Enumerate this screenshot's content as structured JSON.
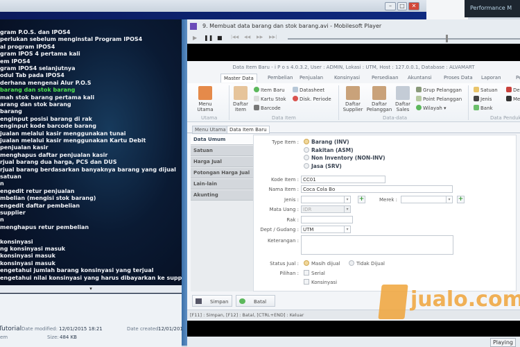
{
  "background_window": {
    "min": "–",
    "max": "□",
    "close": "✕"
  },
  "taskbar": {
    "performance_label": "Performance M"
  },
  "tutorial_list": {
    "items": [
      "gram P.O.S. dan IPOS4",
      "perlukan sebelum menginstal Program IPOS4",
      "al program IPOS4",
      "gram IPOS 4 pertama kali",
      "em IPOS4",
      "gram IPOS4 selanjutnya",
      "odul Tab pada IPOS4",
      "derhana mengenai Alur P.O.S",
      "barang dan stok barang",
      "mah stok barang pertama kali",
      "arang dan stok barang",
      "barang",
      "enginput posisi barang di rak",
      "enginput kode barcode barang",
      "jualan melalui kasir menggunakan tunai",
      "jualan melalui kasir menggunakan Kartu Debit",
      "penjualan kasir",
      "menghapus daftar penjualan kasir",
      "rjual barang dua harga, PCS dan DUS",
      "rjual barang berdasarkan banyaknya barang yang dijual",
      "satuan",
      "n",
      "engedit retur penjualan",
      "mbelian (mengisi stok barang)",
      "engedit daftar pembelian",
      "supplier",
      "n",
      "menghapus retur pembelian",
      "",
      "konsinyasi",
      "ng konsinyasi masuk",
      "konsinyasi masuk",
      "konsinyasi masuk",
      "engetahui jumlah barang konsinyasi yang terjual",
      "engetahui nilai konsinyasi yang harus dibayarkan ke supplier"
    ],
    "highlighted_index": 8,
    "highlight_color": "#4ee24e",
    "scroll_down": "▾"
  },
  "explorer_details": {
    "name": "Tutorial",
    "type": "em",
    "date_modified_label": "Date modified:",
    "date_modified": "12/01/2015 18:21",
    "size_label": "Size:",
    "size": "484 KB",
    "date_created_label": "Date created:",
    "date_created": "12/01/201"
  },
  "player": {
    "title": "9.  Membuat data barang dan stok barang.avi - Mobilesoft Player",
    "controls": [
      "▶",
      "❚❚",
      "■",
      "|◀◀",
      "◀◀",
      "▶▶",
      "▶▶|"
    ],
    "seek_progress": 0.68,
    "status": "Playing"
  },
  "app": {
    "title": "Data Item Baru - i P o s 4.0.3.2,  User : ADMIN, Lokasi : UTM, Host : 127.0.0.1, Database : ALVAMART",
    "tabs": [
      "Master Data",
      "Pembelian",
      "Penjualan",
      "Konsinyasi",
      "Persediaan",
      "Akuntansi",
      "Proses Data",
      "Laporan",
      "Pe"
    ],
    "active_tab": "Master Data",
    "ribbon": {
      "utama": {
        "label": "Utama",
        "menu_utama": "Menu Utama"
      },
      "data_item": {
        "label": "Data Item",
        "daftar_item": "Daftar Item",
        "item_baru": "Item Baru",
        "kartu_stok": "Kartu Stok",
        "barcode": "Barcode",
        "datasheet": "Datasheet",
        "disk_periode": "Disk. Periode"
      },
      "data_data": {
        "label": "Data-data",
        "daftar_supplier": "Daftar Supplier",
        "daftar_pelanggan": "Daftar Pelanggan",
        "daftar_sales": "Daftar Sales",
        "grup_pelanggan": "Grup Pelanggan",
        "point_pelanggan": "Point Pelanggan",
        "wilayah": "Wilayah ▾"
      },
      "data_pendukung": {
        "label": "Data Pendukung",
        "satuan": "Satuan",
        "jenis": "Jenis",
        "bank": "Bank",
        "de": "De",
        "me": "Me"
      }
    },
    "doc_tabs": [
      "Menu Utama",
      "Data Item Baru"
    ],
    "side_nav": [
      "Data Umum",
      "Satuan",
      "Harga Jual",
      "Potongan Harga Jual",
      "Lain-lain",
      "Akunting"
    ],
    "form": {
      "type_item_label": "Type Item :",
      "type_options": [
        "Barang (INV)",
        "Rakitan (ASM)",
        "Non Inventory (NON-INV)",
        "Jasa (SRV)"
      ],
      "type_selected": "Barang (INV)",
      "kode_item_label": "Kode Item :",
      "kode_item": "CC01",
      "nama_item_label": "Nama Item :",
      "nama_item": "Coca Cola Bo",
      "jenis_label": "Jenis :",
      "jenis": "",
      "merek_label": "Merek :",
      "merek": "",
      "mata_uang_label": "Mata Uang :",
      "mata_uang": "IDR",
      "rak_label": "Rak :",
      "rak": "",
      "dept_label": "Dept / Gudang :",
      "dept": "UTM",
      "keterangan_label": "Keterangan :",
      "keterangan": "",
      "status_jual_label": "Status Jual :",
      "status_options": [
        "Masih dijual",
        "Tidak Dijual"
      ],
      "status_selected": "Masih dijual",
      "pilihan_label": "Pilihan :",
      "pilihan_options": [
        {
          "label": "Serial",
          "checked": false
        },
        {
          "label": "Konsinyasi",
          "checked": false
        }
      ]
    },
    "buttons": {
      "simpan": "Simpan",
      "batal": "Batal"
    },
    "status_bar": "[F11] : Simpan, [F12] : Batal, [CTRL+END] : Keluar"
  },
  "watermark": {
    "text": "jualo.com",
    "color": "#f0a53a"
  }
}
